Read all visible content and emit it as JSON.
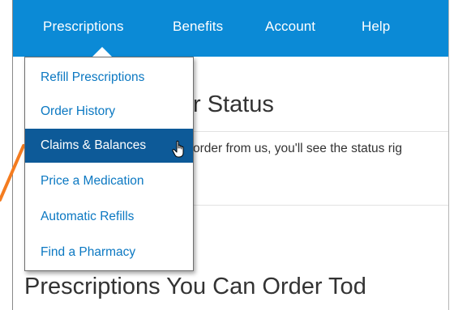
{
  "nav": {
    "items": [
      {
        "label": "Prescriptions"
      },
      {
        "label": "Benefits"
      },
      {
        "label": "Account"
      },
      {
        "label": "Help"
      }
    ],
    "active": "Prescriptions"
  },
  "dropdown": {
    "items": [
      {
        "label": "Refill Prescriptions"
      },
      {
        "label": "Order History"
      },
      {
        "label": "Claims & Balances"
      },
      {
        "label": "Price a Medication"
      },
      {
        "label": "Automatic Refills"
      },
      {
        "label": "Find a Pharmacy"
      }
    ],
    "hovered": "Claims & Balances"
  },
  "page": {
    "heading_partial": "r Status",
    "body_partial": "order from us, you'll see the status rig",
    "section_heading": "Prescriptions You Can Order Tod"
  },
  "colors": {
    "nav_bg": "#0b8ad6",
    "menu_link": "#0b78c2",
    "menu_active_bg": "#0d5a98",
    "annotation": "#f47c20"
  },
  "icons": {
    "cursor": "hand-pointer-icon"
  }
}
